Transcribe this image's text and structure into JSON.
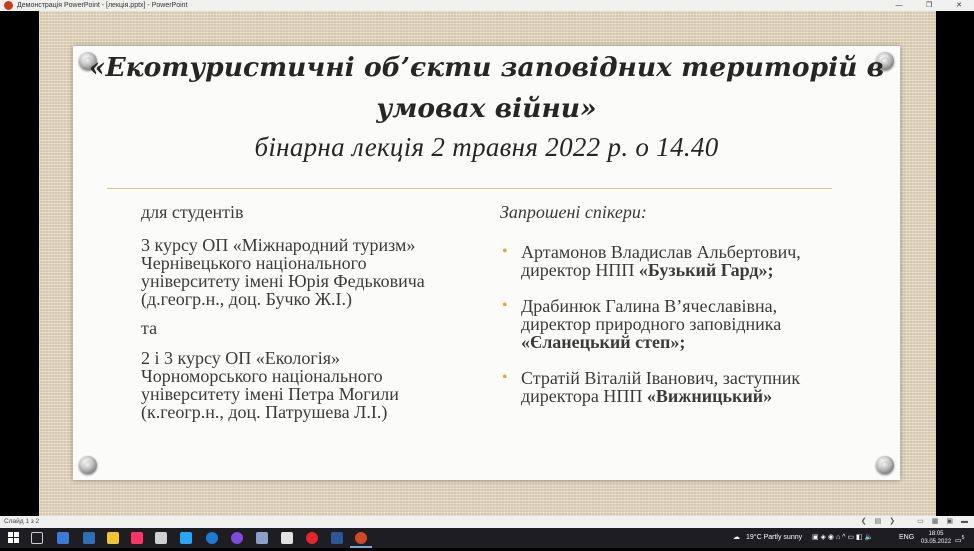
{
  "window": {
    "title": "Демонстрація PowerPoint - [лекція.pptx] - PowerPoint",
    "controls": [
      "—",
      "❐",
      "✕"
    ]
  },
  "slide": {
    "title_line1": "«Екотуристичні об’єкти заповідних територій в",
    "title_line2": "умовах війни»",
    "subtitle": "бінарна лекція 2 травня 2022 р. о 14.40",
    "left": {
      "for_students": "для студентів",
      "group1": [
        "3 курсу ОП «Міжнародний туризм»",
        "Чернівецького національного",
        "університету імені Юрія Федьковича",
        "(д.геогр.н., доц. Бучко Ж.І.)"
      ],
      "and": "та",
      "group2": [
        "2 і 3 курсу ОП «Екологія»",
        "Чорноморського національного",
        "університету імені Петра Могили",
        "(к.геогр.н., доц. Патрушева Л.І.)"
      ]
    },
    "right": {
      "heading": "Запрошені спікери:",
      "speakers": [
        {
          "line1": "Артамонов Владислав Альбертович,",
          "line2_prefix": "директор НПП ",
          "line2_bold": "«Бузький Гард»;",
          "line3": ""
        },
        {
          "line1": "Драбинюк Галина В’ячеславівна,",
          "line2_prefix": "директор природного заповідника",
          "line2_bold": "",
          "line3": "«Єланецький степ»;"
        },
        {
          "line1": "Стратій Віталій Іванович, заступник",
          "line2_prefix": "директора НПП ",
          "line2_bold": "«Вижницький»",
          "line3": ""
        }
      ],
      "bullet": "•"
    }
  },
  "statusbar": {
    "slide_number": "Слайд 1 з 2"
  },
  "taskbar": {
    "weather": "19°C  Partly sunny",
    "language": "ENG",
    "time": "18:05",
    "date": "03.05.2022",
    "notification_count": "5"
  }
}
